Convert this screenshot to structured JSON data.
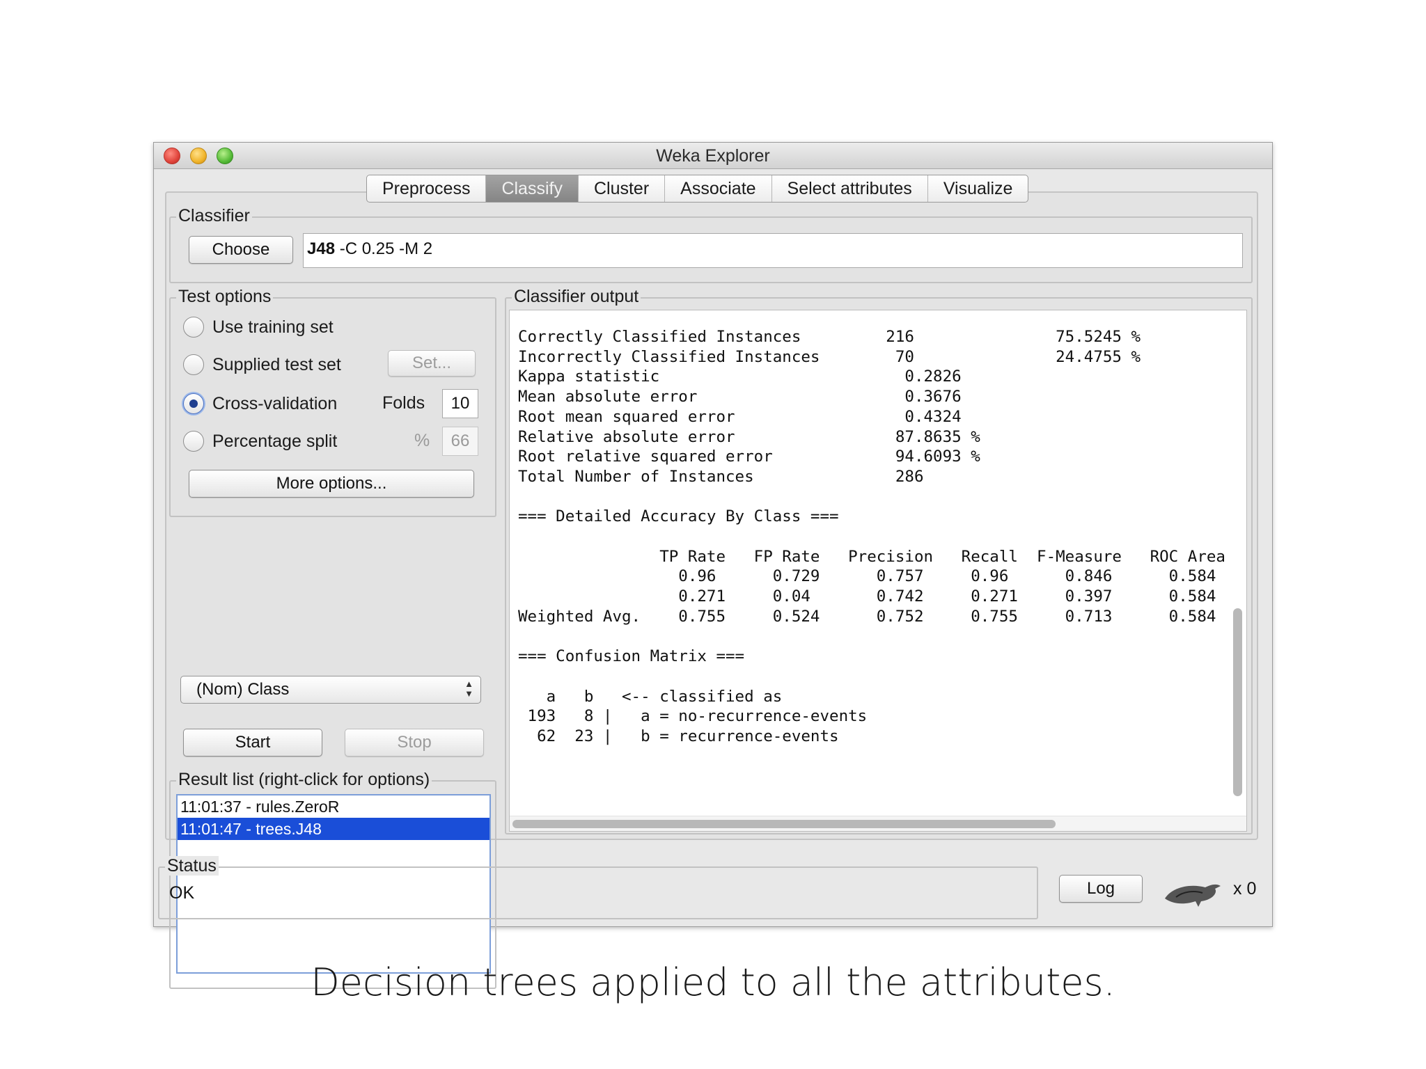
{
  "window": {
    "title": "Weka Explorer"
  },
  "tabs": [
    {
      "label": "Preprocess",
      "active": false
    },
    {
      "label": "Classify",
      "active": true
    },
    {
      "label": "Cluster",
      "active": false
    },
    {
      "label": "Associate",
      "active": false
    },
    {
      "label": "Select attributes",
      "active": false
    },
    {
      "label": "Visualize",
      "active": false
    }
  ],
  "classifier": {
    "group_label": "Classifier",
    "choose_label": "Choose",
    "name": "J48",
    "options": "-C 0.25 -M 2"
  },
  "test_options": {
    "group_label": "Test options",
    "use_training": "Use training set",
    "supplied_test": "Supplied test set",
    "set_button": "Set...",
    "cross_validation": "Cross-validation",
    "folds_label": "Folds",
    "folds_value": "10",
    "percentage_split": "Percentage split",
    "percent_symbol": "%",
    "percent_value": "66",
    "more_options": "More options...",
    "selected": "cross_validation"
  },
  "class_select": {
    "value": "(Nom) Class"
  },
  "controls": {
    "start": "Start",
    "stop": "Stop"
  },
  "result_list": {
    "label": "Result list (right-click for options)",
    "items": [
      {
        "text": "11:01:37 - rules.ZeroR",
        "selected": false
      },
      {
        "text": "11:01:47 - trees.J48",
        "selected": true
      }
    ]
  },
  "output": {
    "label": "Classifier output",
    "lines": [
      "Correctly Classified Instances         216               75.5245 %",
      "Incorrectly Classified Instances        70               24.4755 %",
      "Kappa statistic                          0.2826",
      "Mean absolute error                      0.3676",
      "Root mean squared error                  0.4324",
      "Relative absolute error                 87.8635 %",
      "Root relative squared error             94.6093 %",
      "Total Number of Instances               286",
      "",
      "=== Detailed Accuracy By Class ===",
      "",
      "               TP Rate   FP Rate   Precision   Recall  F-Measure   ROC Area",
      "                 0.96      0.729      0.757     0.96      0.846      0.584",
      "                 0.271     0.04       0.742     0.271     0.397      0.584",
      "Weighted Avg.    0.755     0.524      0.752     0.755     0.713      0.584",
      "",
      "=== Confusion Matrix ===",
      "",
      "   a   b   <-- classified as",
      " 193   8 |   a = no-recurrence-events",
      "  62  23 |   b = recurrence-events"
    ]
  },
  "status": {
    "label": "Status",
    "text": "OK",
    "log_button": "Log",
    "count": "x 0"
  },
  "caption": "Decision trees applied to all the attributes.",
  "colors": {
    "selection": "#1a4ed8",
    "active_tab": "#959595"
  }
}
